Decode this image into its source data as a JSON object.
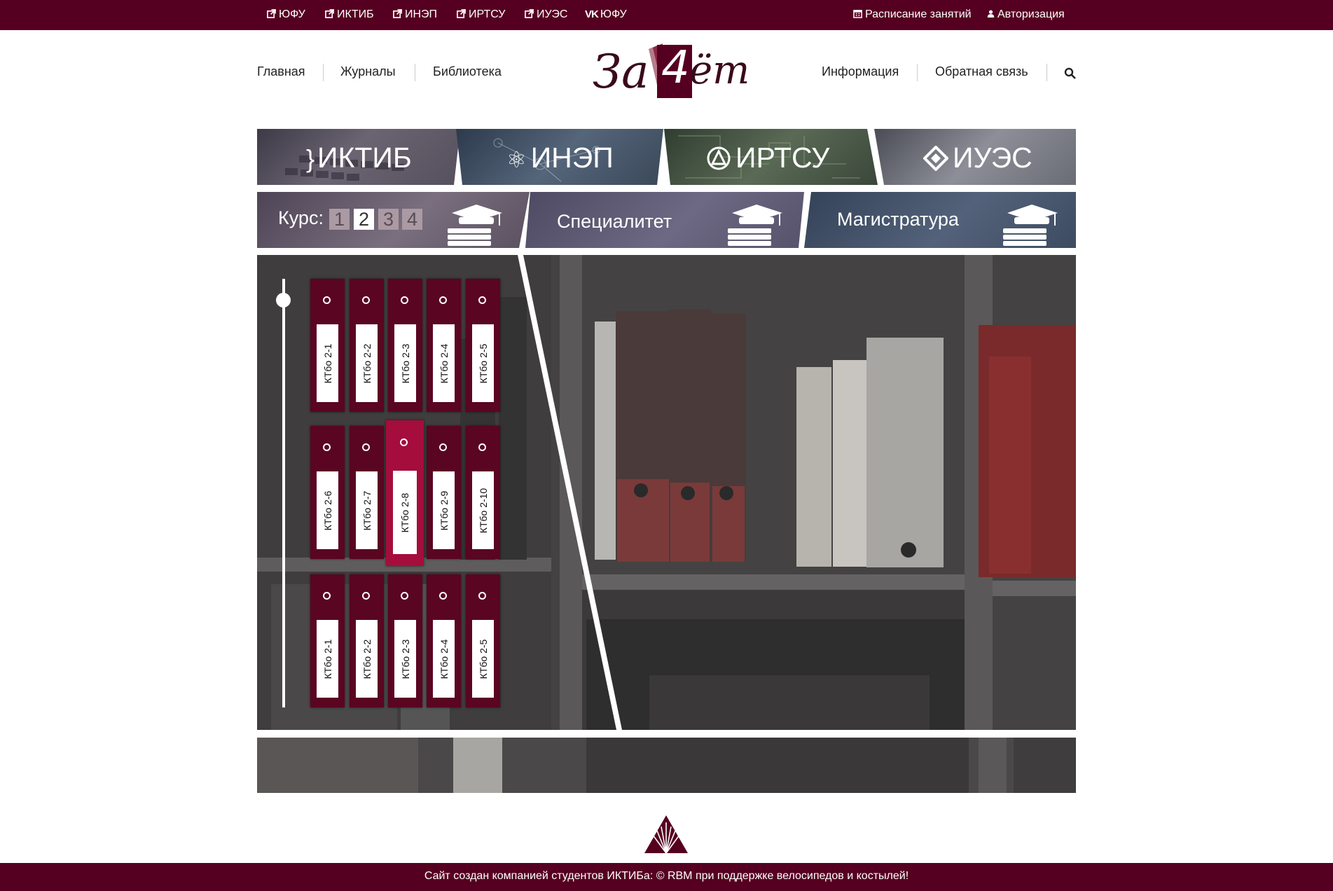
{
  "topbar": {
    "links": [
      "ЮФУ",
      "ИКТИБ",
      "ИНЭП",
      "ИРТСУ",
      "ИУЭС",
      "ЮФУ"
    ],
    "schedule": "Расписание занятий",
    "auth": "Авторизация"
  },
  "nav": {
    "left": [
      "Главная",
      "Журналы",
      "Библиотека"
    ],
    "right": [
      "Информация",
      "Обратная связь"
    ]
  },
  "logo": {
    "text_left": "За",
    "digit": "4",
    "text_right": "ёт"
  },
  "institutes": [
    "ИКТИБ",
    "ИНЭП",
    "ИРТСУ",
    "ИУЭС"
  ],
  "course": {
    "label": "Курс:",
    "numbers": [
      "1",
      "2",
      "3",
      "4"
    ],
    "selected": "2",
    "programs": [
      "Специалитет",
      "Магистратура"
    ]
  },
  "groups": {
    "row1": [
      "КТбо 2-1",
      "КТбо 2-2",
      "КТбо 2-3",
      "КТбо 2-4",
      "КТбо 2-5"
    ],
    "row2": [
      "КТбо 2-6",
      "КТбо 2-7",
      "КТбо 2-8",
      "КТбо 2-9",
      "КТбо 2-10"
    ],
    "row3": [
      "КТбо 2-1",
      "КТбо 2-2",
      "КТбо 2-3",
      "КТбо 2-4",
      "КТбо 2-5"
    ],
    "selected": "КТбо 2-8"
  },
  "footer": "Сайт создан компанией студентов ИКТИБа: © RBM при поддержке велосипедов и костылей!",
  "colors": {
    "brand": "#560021",
    "folder": "#5a0522",
    "folder_selected": "#a50d3c"
  }
}
